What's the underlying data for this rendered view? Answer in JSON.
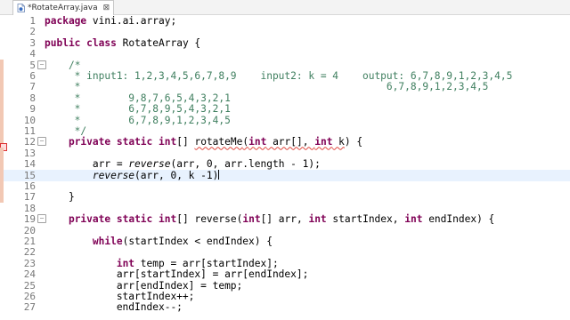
{
  "tab": {
    "title": "*RotateArray.java",
    "close": "⊠",
    "icon": "java-file-icon"
  },
  "colors": {
    "keyword": "#7f0055",
    "comment": "#3f7f5f",
    "line_number": "#787878",
    "marker": "#f2c8b4",
    "current_line": "#e8f2fe"
  },
  "lines": [
    {
      "n": "1",
      "tokens": [
        {
          "t": "package",
          "c": "kw"
        },
        {
          "t": " vini.ai.array;"
        }
      ]
    },
    {
      "n": "2",
      "tokens": []
    },
    {
      "n": "3",
      "tokens": [
        {
          "t": "public",
          "c": "kw"
        },
        {
          "t": " "
        },
        {
          "t": "class",
          "c": "kw"
        },
        {
          "t": " RotateArray {"
        }
      ]
    },
    {
      "n": "4",
      "tokens": []
    },
    {
      "n": "5",
      "fold": "−",
      "marker": true,
      "tokens": [
        {
          "t": "    "
        },
        {
          "t": "/*",
          "c": "cm"
        }
      ]
    },
    {
      "n": "6",
      "marker": true,
      "tokens": [
        {
          "t": "     * input1: 1,2,3,4,5,6,7,8,9    input2: k = 4    output: 6,7,8,9,1,2,3,4,5",
          "c": "cm"
        }
      ]
    },
    {
      "n": "7",
      "marker": true,
      "tokens": [
        {
          "t": "     *                                                   6,7,8,9,1,2,3,4,5",
          "c": "cm"
        }
      ]
    },
    {
      "n": "8",
      "marker": true,
      "tokens": [
        {
          "t": "     *        9,8,7,6,5,4,3,2,1",
          "c": "cm"
        }
      ]
    },
    {
      "n": "9",
      "marker": true,
      "tokens": [
        {
          "t": "     *        6,7,8,9,5,4,3,2,1",
          "c": "cm"
        }
      ]
    },
    {
      "n": "10",
      "marker": true,
      "tokens": [
        {
          "t": "     *        6,7,8,9,1,2,3,4,5",
          "c": "cm"
        }
      ]
    },
    {
      "n": "11",
      "marker": true,
      "tokens": [
        {
          "t": "     */",
          "c": "cm"
        }
      ]
    },
    {
      "n": "12",
      "fold": "−",
      "marker": true,
      "error": true,
      "tokens": [
        {
          "t": "    "
        },
        {
          "t": "private",
          "c": "kw"
        },
        {
          "t": " "
        },
        {
          "t": "static",
          "c": "kw"
        },
        {
          "t": " "
        },
        {
          "t": "int",
          "c": "kw"
        },
        {
          "t": "[] "
        },
        {
          "t": "rotateMe",
          "c": "err"
        },
        {
          "t": "(",
          "c": "err"
        },
        {
          "t": "int",
          "c": "kw err"
        },
        {
          "t": " arr[], ",
          "c": "err"
        },
        {
          "t": "int",
          "c": "kw err"
        },
        {
          "t": " k",
          "c": "err"
        },
        {
          "t": ") {"
        }
      ]
    },
    {
      "n": "13",
      "marker": true,
      "tokens": []
    },
    {
      "n": "14",
      "marker": true,
      "tokens": [
        {
          "t": "        arr = "
        },
        {
          "t": "reverse",
          "c": "it"
        },
        {
          "t": "(arr, 0, arr.length - 1);"
        }
      ]
    },
    {
      "n": "15",
      "marker": true,
      "current": true,
      "tokens": [
        {
          "t": "        "
        },
        {
          "t": "reverse",
          "c": "it"
        },
        {
          "t": "(arr, 0, k -1)"
        }
      ],
      "caret": true
    },
    {
      "n": "16",
      "marker": true,
      "tokens": []
    },
    {
      "n": "17",
      "marker": true,
      "tokens": [
        {
          "t": "    }"
        }
      ]
    },
    {
      "n": "18",
      "tokens": []
    },
    {
      "n": "19",
      "fold": "−",
      "tokens": [
        {
          "t": "    "
        },
        {
          "t": "private",
          "c": "kw"
        },
        {
          "t": " "
        },
        {
          "t": "static",
          "c": "kw"
        },
        {
          "t": " "
        },
        {
          "t": "int",
          "c": "kw"
        },
        {
          "t": "[] reverse("
        },
        {
          "t": "int",
          "c": "kw"
        },
        {
          "t": "[] arr, "
        },
        {
          "t": "int",
          "c": "kw"
        },
        {
          "t": " startIndex, "
        },
        {
          "t": "int",
          "c": "kw"
        },
        {
          "t": " endIndex) {"
        }
      ]
    },
    {
      "n": "20",
      "tokens": []
    },
    {
      "n": "21",
      "tokens": [
        {
          "t": "        "
        },
        {
          "t": "while",
          "c": "kw"
        },
        {
          "t": "(startIndex < endIndex) {"
        }
      ]
    },
    {
      "n": "22",
      "tokens": []
    },
    {
      "n": "23",
      "tokens": [
        {
          "t": "            "
        },
        {
          "t": "int",
          "c": "kw"
        },
        {
          "t": " temp = arr[startIndex];"
        }
      ]
    },
    {
      "n": "24",
      "tokens": [
        {
          "t": "            arr[startIndex] = arr[endIndex];"
        }
      ]
    },
    {
      "n": "25",
      "tokens": [
        {
          "t": "            arr[endIndex] = temp;"
        }
      ]
    },
    {
      "n": "26",
      "tokens": [
        {
          "t": "            startIndex++;"
        }
      ]
    },
    {
      "n": "27",
      "tokens": [
        {
          "t": "            endIndex--;"
        }
      ]
    }
  ]
}
